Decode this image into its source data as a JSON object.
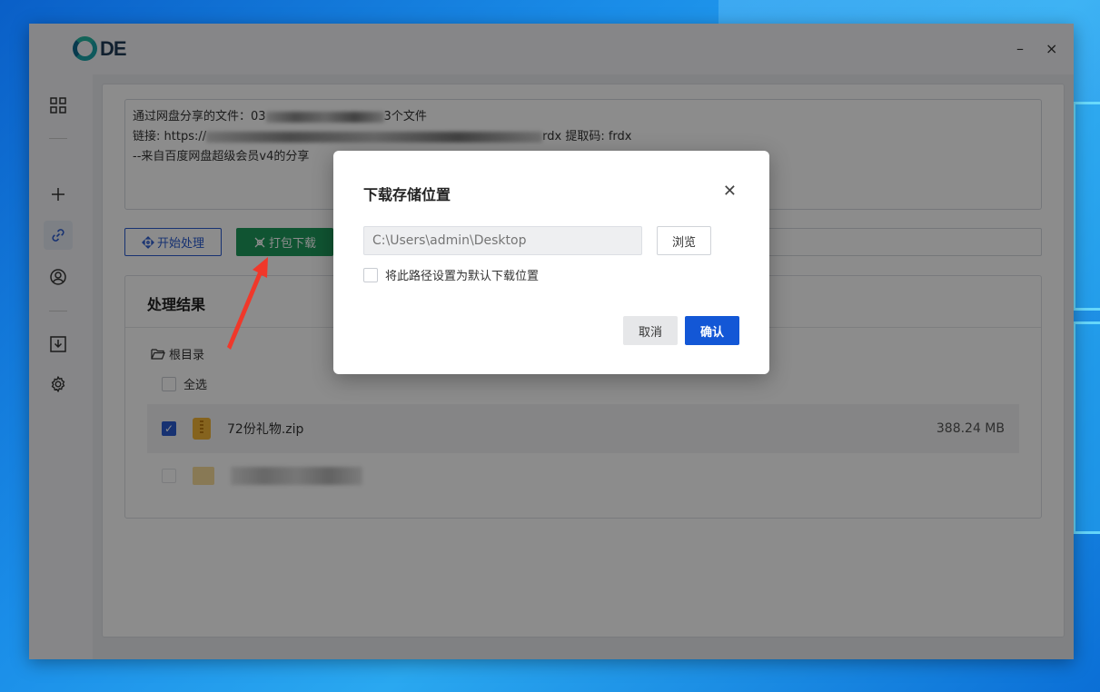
{
  "app": {
    "logo_text": "DE"
  },
  "window_controls": {
    "minimize": "–",
    "close": "×"
  },
  "sidebar": {
    "items": [
      {
        "icon": "grid-icon"
      },
      {
        "icon": "plus-icon"
      },
      {
        "icon": "link-icon",
        "active": true
      },
      {
        "icon": "user-icon"
      },
      {
        "icon": "download-icon"
      },
      {
        "icon": "gear-icon"
      }
    ]
  },
  "share_text": {
    "line1_prefix": "通过网盘分享的文件：03",
    "line1_suffix": "3个文件",
    "line2_prefix": "链接: https://",
    "line2_suffix": "rdx 提取码: frdx",
    "line3": "--来自百度网盘超级会员v4的分享"
  },
  "toolbar": {
    "start_label": "开始处理",
    "pack_label": "打包下载"
  },
  "results": {
    "title": "处理结果",
    "root_label": "根目录",
    "select_all_label": "全选",
    "files": [
      {
        "name": "72份礼物.zip",
        "size": "388.24 MB",
        "checked": true
      }
    ]
  },
  "dialog": {
    "title": "下载存储位置",
    "path_placeholder": "C:\\Users\\admin\\Desktop",
    "browse_label": "浏览",
    "default_label": "将此路径设置为默认下载位置",
    "cancel_label": "取消",
    "ok_label": "确认"
  },
  "colors": {
    "accent": "#1357d6",
    "pack_green": "#1e9a5c",
    "arrow_red": "#f0382a"
  }
}
